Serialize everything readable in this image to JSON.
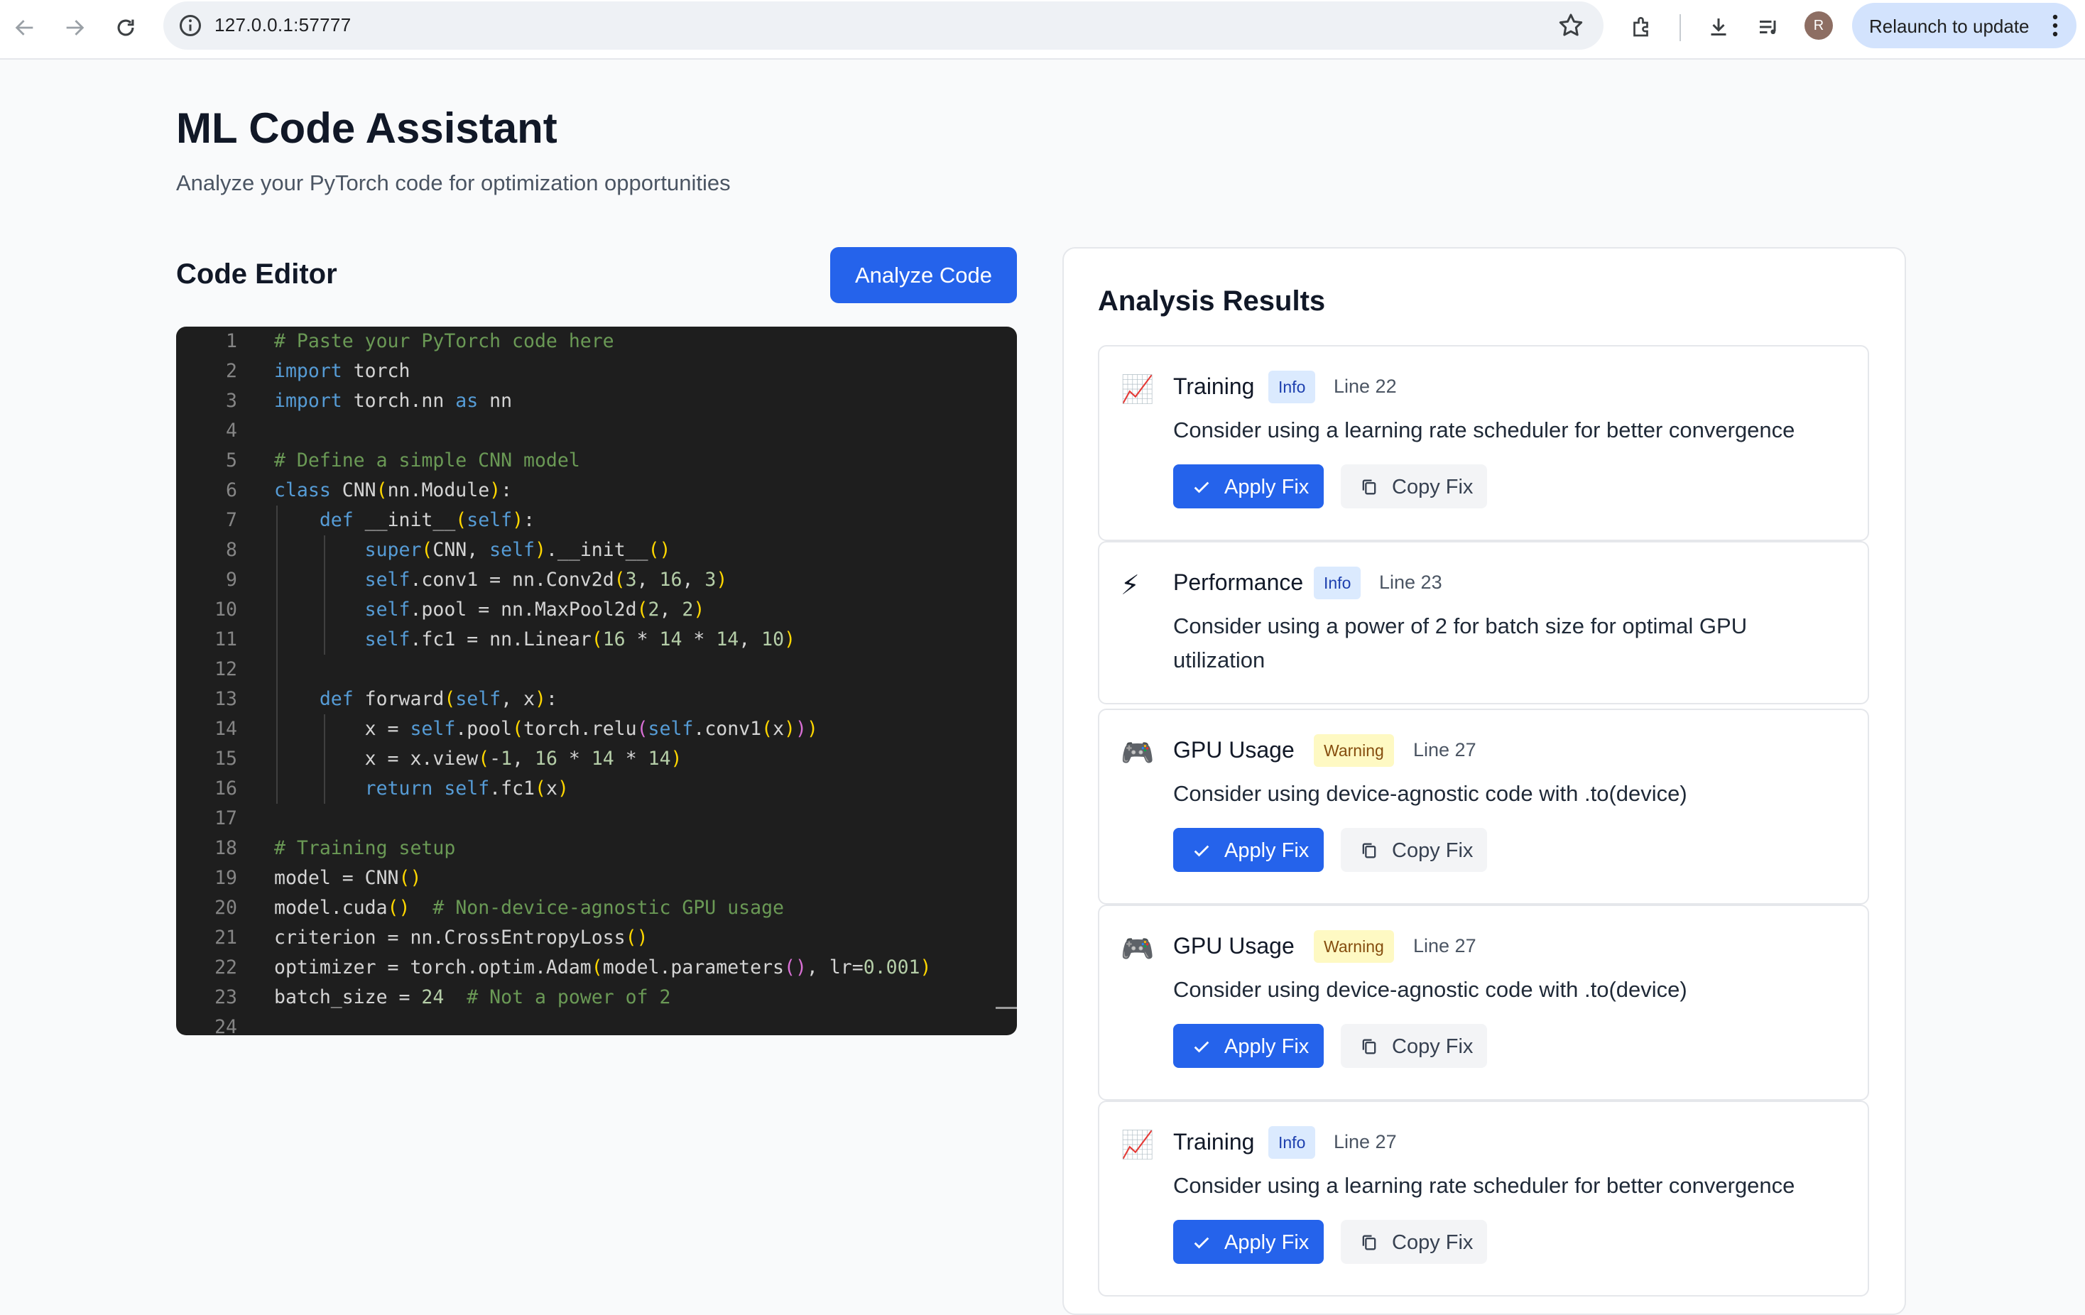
{
  "browser": {
    "url": "127.0.0.1:57777",
    "avatar_initial": "R",
    "relaunch_label": "Relaunch to update"
  },
  "page": {
    "title": "ML Code Assistant",
    "subtitle": "Analyze your PyTorch code for optimization opportunities"
  },
  "editor": {
    "heading": "Code Editor",
    "analyze_label": "Analyze Code",
    "lines": [
      "# Paste your PyTorch code here",
      "import torch",
      "import torch.nn as nn",
      "",
      "# Define a simple CNN model",
      "class CNN(nn.Module):",
      "    def __init__(self):",
      "        super(CNN, self).__init__()",
      "        self.conv1 = nn.Conv2d(3, 16, 3)",
      "        self.pool = nn.MaxPool2d(2, 2)",
      "        self.fc1 = nn.Linear(16 * 14 * 14, 10)",
      "",
      "    def forward(self, x):",
      "        x = self.pool(torch.relu(self.conv1(x)))",
      "        x = x.view(-1, 16 * 14 * 14)",
      "        return self.fc1(x)",
      "",
      "# Training setup",
      "model = CNN()",
      "model.cuda()  # Non-device-agnostic GPU usage",
      "criterion = nn.CrossEntropyLoss()",
      "optimizer = torch.optim.Adam(model.parameters(), lr=0.001)",
      "batch_size = 24  # Not a power of 2",
      ""
    ],
    "colors": {
      "comment": "#6a9955",
      "keyword": "#569cd6",
      "number": "#b5cea8",
      "bracket1": "#ffd700",
      "bracket2": "#da70d6"
    }
  },
  "results": {
    "heading": "Analysis Results",
    "apply_label": "Apply Fix",
    "copy_label": "Copy Fix",
    "items": [
      {
        "icon": "chart-increasing-icon",
        "category": "Training",
        "severity": "Info",
        "line": "Line 22",
        "message": "Consider using a learning rate scheduler for better convergence",
        "has_fix": true
      },
      {
        "icon": "lightning-icon",
        "category": "Performance",
        "severity": "Info",
        "line": "Line 23",
        "message": "Consider using a power of 2 for batch size for optimal GPU utilization",
        "has_fix": false
      },
      {
        "icon": "gamepad-icon",
        "category": "GPU Usage",
        "severity": "Warning",
        "line": "Line 27",
        "message": "Consider using device-agnostic code with .to(device)",
        "has_fix": true
      },
      {
        "icon": "gamepad-icon",
        "category": "GPU Usage",
        "severity": "Warning",
        "line": "Line 27",
        "message": "Consider using device-agnostic code with .to(device)",
        "has_fix": true
      },
      {
        "icon": "chart-increasing-icon",
        "category": "Training",
        "severity": "Info",
        "line": "Line 27",
        "message": "Consider using a learning rate scheduler for better convergence",
        "has_fix": true
      }
    ]
  },
  "colors": {
    "primary": "#2563eb",
    "info_bg": "#dbeafe",
    "warning_bg": "#fef9c3"
  }
}
